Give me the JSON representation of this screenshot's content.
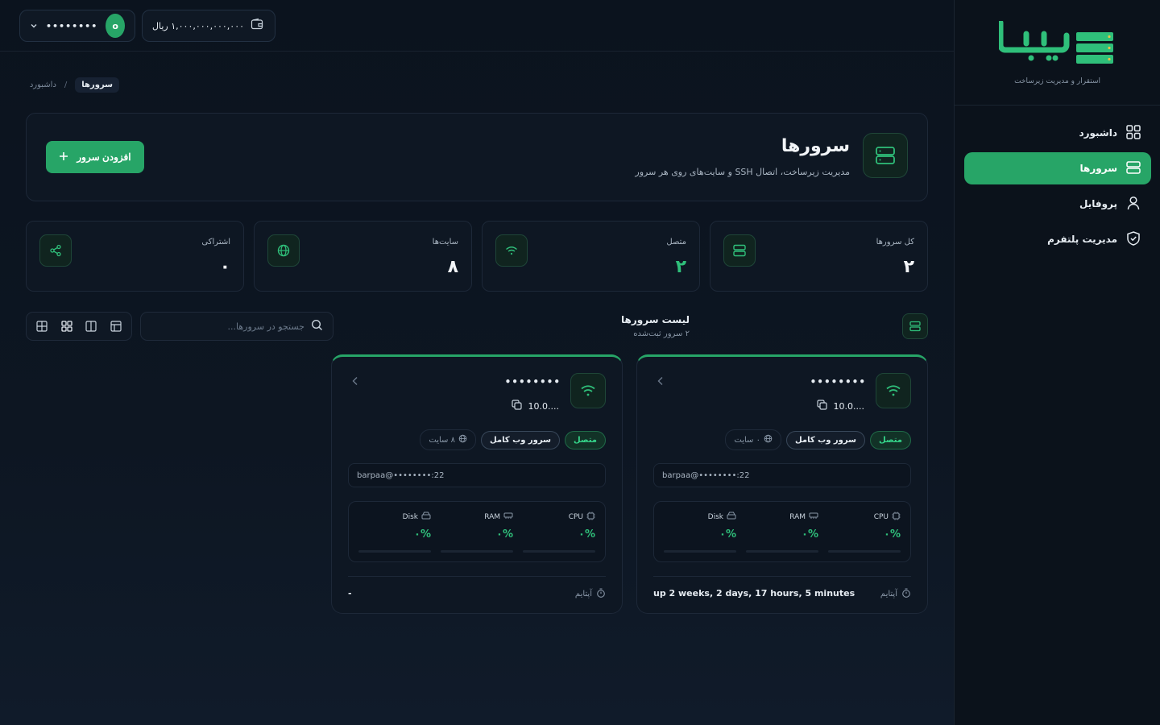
{
  "topbar": {
    "user_name": "••••••••",
    "avatar_letter": "o",
    "wallet_amount": "۱,۰۰۰,۰۰۰,۰۰۰,۰۰۰ ریال"
  },
  "breadcrumb": {
    "current": "سرورها",
    "separator": "/",
    "parent": "داشبورد"
  },
  "header": {
    "title": "سرورها",
    "subtitle": "مدیریت زیرساخت، اتصال SSH و سایت‌های روی هر سرور",
    "add_button": "افزودن سرور"
  },
  "stats": [
    {
      "label": "کل سرورها",
      "value": "۲",
      "icon": "server-icon"
    },
    {
      "label": "متصل",
      "value": "۲",
      "icon": "wifi-icon"
    },
    {
      "label": "سایت‌ها",
      "value": "۸",
      "icon": "globe-icon"
    },
    {
      "label": "اشتراکی",
      "value": "۰",
      "icon": "share-icon"
    }
  ],
  "list": {
    "title": "لیست سرورها",
    "subtitle": "۲ سرور ثبت‌شده",
    "search_placeholder": "جستجو در سرورها..."
  },
  "cards": [
    {
      "name": "••••••••",
      "ip": "10.0....",
      "status": "متصل",
      "type": "سرور وب کامل",
      "sites": "۰ سایت",
      "ssh": "barpaa@••••••••:22",
      "metrics": [
        {
          "label": "CPU",
          "value": "۰%",
          "percent": 0
        },
        {
          "label": "RAM",
          "value": "۰%",
          "percent": 0
        },
        {
          "label": "Disk",
          "value": "۰%",
          "percent": 0
        }
      ],
      "uptime_label": "آپتایم",
      "uptime_value": "up 2 weeks, 2 days, 17 hours, 5 minutes"
    },
    {
      "name": "••••••••",
      "ip": "10.0....",
      "status": "متصل",
      "type": "سرور وب کامل",
      "sites": "۸ سایت",
      "ssh": "barpaa@••••••••:22",
      "metrics": [
        {
          "label": "CPU",
          "value": "۰%",
          "percent": 0
        },
        {
          "label": "RAM",
          "value": "۰%",
          "percent": 0
        },
        {
          "label": "Disk",
          "value": "۰%",
          "percent": 0
        }
      ],
      "uptime_label": "آپتایم",
      "uptime_value": "-"
    }
  ],
  "sidebar": {
    "logo_text": "برپا",
    "tagline": "استقرار و مدیریت زیرساخت",
    "items": [
      {
        "label": "داشبورد",
        "icon": "grid-icon",
        "active": false
      },
      {
        "label": "سرورها",
        "icon": "server-icon",
        "active": true
      },
      {
        "label": "پروفایل",
        "icon": "user-icon",
        "active": false
      },
      {
        "label": "مدیریت پلتفرم",
        "icon": "shield-check-icon",
        "active": false
      }
    ]
  },
  "colors": {
    "accent": "#27a567",
    "background": "#0c1420",
    "card": "#0e1723"
  }
}
